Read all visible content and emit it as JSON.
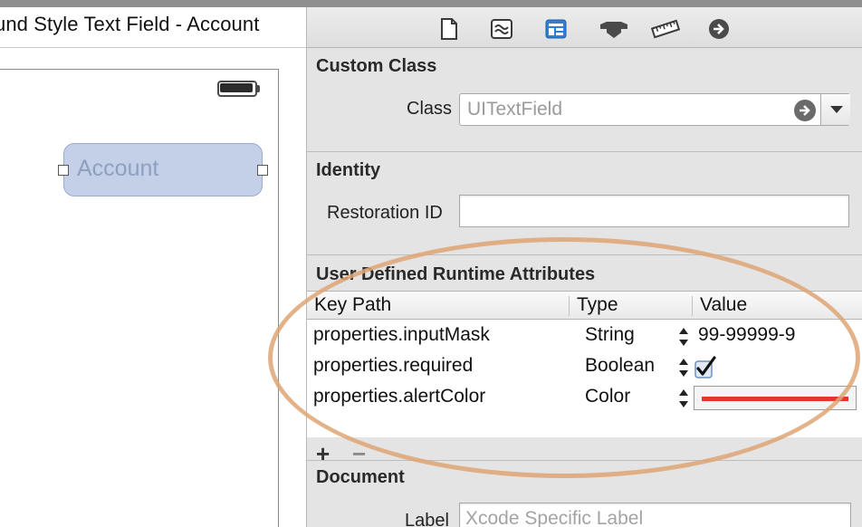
{
  "window": {
    "title": "und Style Text Field - Account"
  },
  "canvas": {
    "text_field_placeholder": "Account"
  },
  "inspector_tabs": [
    {
      "icon": "file-icon"
    },
    {
      "icon": "quick-help-icon"
    },
    {
      "icon": "identity-icon",
      "selected": true
    },
    {
      "icon": "attributes-icon"
    },
    {
      "icon": "size-ruler-icon"
    },
    {
      "icon": "connections-arrow-icon"
    }
  ],
  "custom_class": {
    "title": "Custom Class",
    "class_label": "Class",
    "class_value": "UITextField"
  },
  "identity": {
    "title": "Identity",
    "restoration_label": "Restoration ID",
    "restoration_value": ""
  },
  "runtime_attributes": {
    "title": "User Defined Runtime Attributes",
    "columns": [
      "Key Path",
      "Type",
      "Value"
    ],
    "rows": [
      {
        "key_path": "properties.inputMask",
        "type": "String",
        "value": "99-99999-9"
      },
      {
        "key_path": "properties.required",
        "type": "Boolean",
        "value": "checked"
      },
      {
        "key_path": "properties.alertColor",
        "type": "Color",
        "value": "#e8342a"
      }
    ],
    "add_label": "+",
    "remove_label": "−"
  },
  "document": {
    "title": "Document",
    "label_label": "Label",
    "label_placeholder": "Xcode Specific Label"
  },
  "colors": {
    "selected_tab": "#2f7fd6",
    "highlight": "#dea473",
    "alert_color": "#e8342a"
  }
}
